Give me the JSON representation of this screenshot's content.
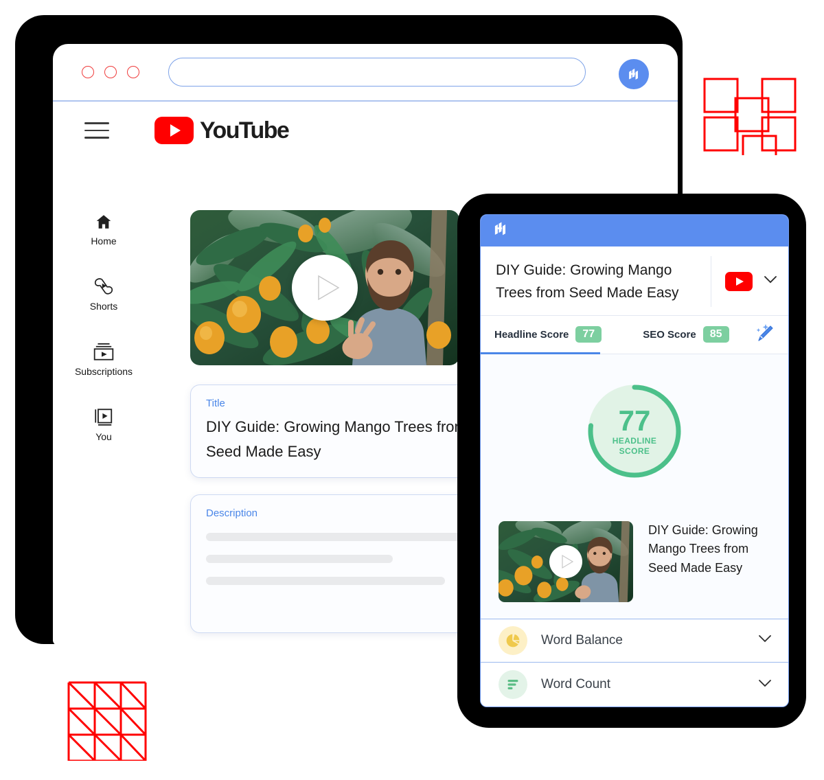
{
  "browser": {
    "traffic_lights": [
      "close",
      "minimize",
      "maximize"
    ],
    "url_value": "",
    "url_placeholder": "",
    "brand_icon": "mangools-logo-icon"
  },
  "youtube": {
    "wordmark": "YouTube",
    "menu_icon": "hamburger-menu-icon",
    "logo_icon": "youtube-play-icon",
    "sidebar": [
      {
        "label": "Home",
        "icon": "home-icon"
      },
      {
        "label": "Shorts",
        "icon": "shorts-icon"
      },
      {
        "label": "Subscriptions",
        "icon": "subscriptions-icon"
      },
      {
        "label": "You",
        "icon": "you-library-icon"
      }
    ],
    "video": {
      "play_icon": "play-button-icon",
      "alt": "Man standing in a mango orchard with ripe mangoes on leafy branches"
    },
    "title_field": {
      "label": "Title",
      "value": "DIY Guide: Growing Mango Trees from Seed Made Easy",
      "badge_icon": "mangools-logo-icon"
    },
    "description_field": {
      "label": "Description",
      "placeholder_lines": 3
    }
  },
  "popup": {
    "topbar_icon": "mangools-logo-icon",
    "title": "DIY Guide: Growing Mango Trees from Seed Made Easy",
    "platform_icon": "youtube-play-icon",
    "expand_icon": "chevron-down-icon",
    "tabs": [
      {
        "label": "Headline Score",
        "score": "77",
        "active": true
      },
      {
        "label": "SEO Score",
        "score": "85",
        "active": false
      }
    ],
    "magic_icon": "magic-wand-edit-icon",
    "score_ring": {
      "value": "77",
      "percent": 77,
      "caption_line1": "HEADLINE",
      "caption_line2": "SCORE"
    },
    "video": {
      "play_icon": "play-button-icon",
      "title": "DIY Guide: Growing Mango Trees from Seed Made Easy"
    },
    "accordions": [
      {
        "label": "Word Balance",
        "icon": "pie-chart-icon",
        "chevron": "chevron-down-icon"
      },
      {
        "label": "Word Count",
        "icon": "bar-list-icon",
        "chevron": "chevron-down-icon"
      }
    ]
  },
  "decor": {
    "squares_color": "#ff0000",
    "triangles_color": "#ff0000"
  },
  "colors": {
    "brand_blue": "#5b8def",
    "youtube_red": "#ff0000",
    "score_green": "#7dcfa0",
    "ring_green": "#4cc08a",
    "bezel": "#000000"
  }
}
